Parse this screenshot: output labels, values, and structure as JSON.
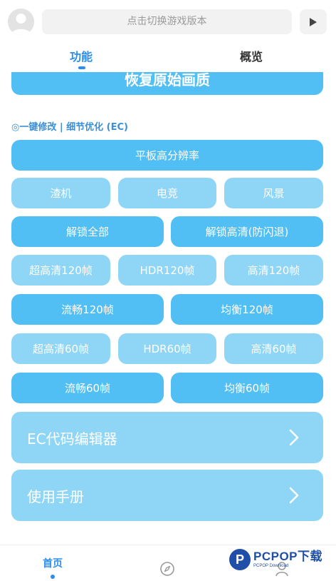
{
  "header": {
    "version_placeholder": "点击切换游戏版本"
  },
  "tabs": [
    {
      "label": "功能"
    },
    {
      "label": "概览"
    }
  ],
  "restore_label": "恢复原始画质",
  "section_title": "◎一键修改 | 细节优化 (EC)",
  "buttons": {
    "tablet_res": "平板高分辨率",
    "low_end": "渣机",
    "esports": "电竞",
    "scenery": "风景",
    "unlock_all": "解锁全部",
    "unlock_hd": "解锁高清(防闪退)",
    "uhd_120": "超高清120帧",
    "hdr_120": "HDR120帧",
    "hd_120": "高清120帧",
    "smooth_120": "流畅120帧",
    "balanced_120": "均衡120帧",
    "uhd_60": "超高清60帧",
    "hdr_60": "HDR60帧",
    "hd_60": "高清60帧",
    "smooth_60": "流畅60帧",
    "balanced_60": "均衡60帧"
  },
  "ec_editor_label": "EC代码编辑器",
  "manual_label": "使用手册",
  "bottom_nav": {
    "home": "首页"
  },
  "watermark": {
    "logo": "P",
    "main": "PCPOP下载",
    "sub": "PCPOP Download"
  },
  "colors": {
    "accent": "#2a8ef0",
    "button_dark": "#52bff4",
    "button_light": "#8fd6f6"
  },
  "icons": [
    "avatar-icon",
    "play-icon",
    "chevron-right-icon",
    "compass-icon",
    "user-icon"
  ]
}
